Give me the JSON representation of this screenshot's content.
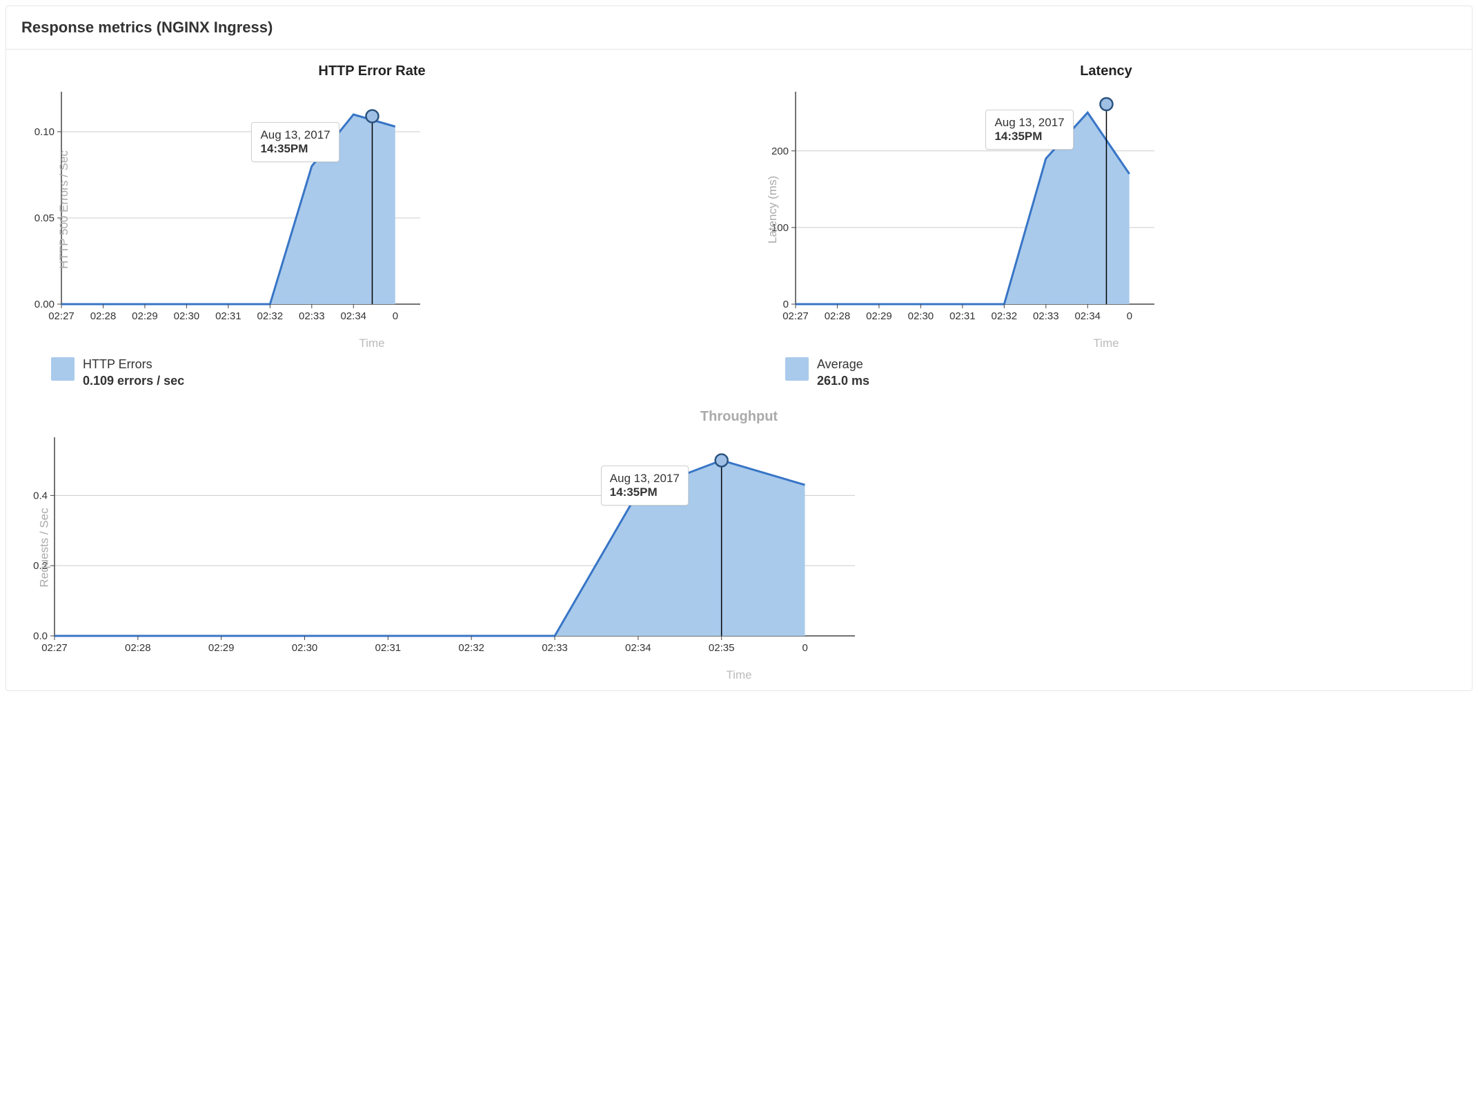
{
  "panel": {
    "title": "Response metrics (NGINX Ingress)"
  },
  "tooltip": {
    "date": "Aug 13, 2017",
    "time": "14:35PM"
  },
  "charts": {
    "error_rate": {
      "title": "HTTP Error Rate",
      "ylabel": "HTTP 500 Errors / Sec",
      "xlabel": "Time",
      "legend_label": "HTTP Errors",
      "legend_value": "0.109 errors / sec"
    },
    "latency": {
      "title": "Latency",
      "ylabel": "Latency (ms)",
      "xlabel": "Time",
      "legend_label": "Average",
      "legend_value": "261.0 ms"
    },
    "throughput": {
      "title": "Throughput",
      "ylabel": "Requests / Sec",
      "xlabel": "Time"
    }
  },
  "chart_data": [
    {
      "id": "error_rate",
      "type": "area",
      "title": "HTTP Error Rate",
      "xlabel": "Time",
      "ylabel": "HTTP 500 Errors / Sec",
      "y_ticks": [
        0.0,
        0.05,
        0.1
      ],
      "ylim": [
        0,
        0.12
      ],
      "categories": [
        "02:27",
        "02:28",
        "02:29",
        "02:30",
        "02:31",
        "02:32",
        "02:33",
        "02:34"
      ],
      "series": [
        {
          "name": "HTTP Errors",
          "values": [
            0,
            0,
            0,
            0,
            0,
            0,
            0.08,
            0.11
          ]
        }
      ],
      "trailing_values": [
        0.103
      ],
      "marker": {
        "x_fraction_after_last": 0.45,
        "y": 0.109
      },
      "tooltip": {
        "date": "Aug 13, 2017",
        "time": "14:35PM"
      },
      "summary_value": "0.109 errors / sec"
    },
    {
      "id": "latency",
      "type": "area",
      "title": "Latency",
      "xlabel": "Time",
      "ylabel": "Latency (ms)",
      "y_ticks": [
        0,
        100,
        200
      ],
      "ylim": [
        0,
        270
      ],
      "categories": [
        "02:27",
        "02:28",
        "02:29",
        "02:30",
        "02:31",
        "02:32",
        "02:33",
        "02:34"
      ],
      "series": [
        {
          "name": "Average",
          "values": [
            0,
            0,
            0,
            0,
            0,
            0,
            190,
            250
          ]
        }
      ],
      "trailing_values": [
        170
      ],
      "marker": {
        "x_fraction_after_last": 0.45,
        "y": 261
      },
      "tooltip": {
        "date": "Aug 13, 2017",
        "time": "14:35PM"
      },
      "summary_value": "261.0 ms"
    },
    {
      "id": "throughput",
      "type": "area",
      "title": "Throughput",
      "xlabel": "Time",
      "ylabel": "Requests / Sec",
      "y_ticks": [
        0.0,
        0.2,
        0.4
      ],
      "ylim": [
        0,
        0.55
      ],
      "categories": [
        "02:27",
        "02:28",
        "02:29",
        "02:30",
        "02:31",
        "02:32",
        "02:33",
        "02:34",
        "02:35"
      ],
      "series": [
        {
          "name": "Throughput",
          "values": [
            0,
            0,
            0,
            0,
            0,
            0,
            0,
            0.41,
            0.5
          ]
        }
      ],
      "trailing_values": [
        0.43
      ],
      "marker": {
        "x_index": 8,
        "y": 0.5
      },
      "tooltip": {
        "date": "Aug 13, 2017",
        "time": "14:35PM"
      }
    }
  ]
}
